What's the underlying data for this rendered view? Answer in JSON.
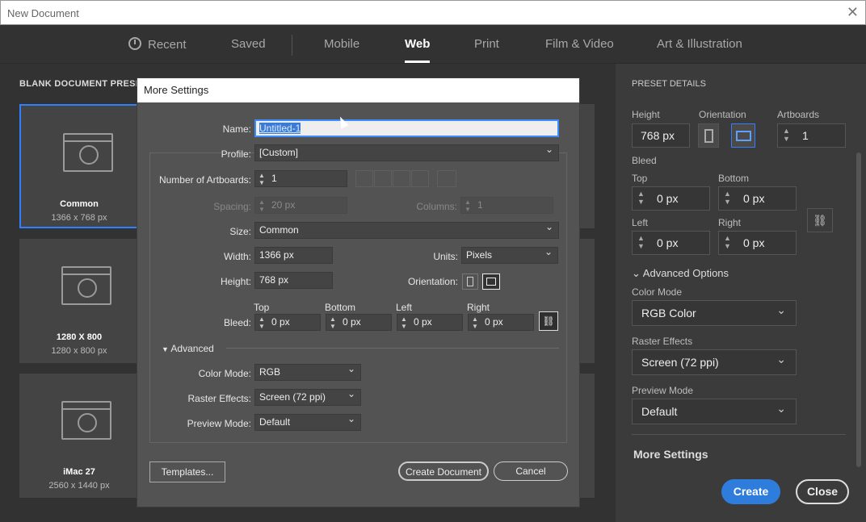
{
  "window": {
    "title": "New Document",
    "close": "✕"
  },
  "tabs": [
    {
      "label": "Recent"
    },
    {
      "label": "Saved"
    },
    {
      "label": "Mobile"
    },
    {
      "label": "Web"
    },
    {
      "label": "Print"
    },
    {
      "label": "Film & Video"
    },
    {
      "label": "Art & Illustration"
    }
  ],
  "presets": {
    "header": "BLANK DOCUMENT PRESETS",
    "items": [
      {
        "name": "Common",
        "size": "1366 x 768 px"
      },
      {
        "name": "1280 X 800",
        "size": "1280 x 800 px"
      },
      {
        "name": "iMac 27",
        "size": "2560 x 1440 px"
      }
    ]
  },
  "details": {
    "header": "PRESET DETAILS",
    "height_label": "Height",
    "height": "768 px",
    "orientation_label": "Orientation",
    "artboards_label": "Artboards",
    "artboards": "1",
    "bleed_label": "Bleed",
    "top_label": "Top",
    "top": "0 px",
    "bottom_label": "Bottom",
    "bottom": "0 px",
    "left_label": "Left",
    "left": "0 px",
    "right_label": "Right",
    "right": "0 px",
    "advanced": "Advanced Options",
    "color_mode_label": "Color Mode",
    "color_mode": "RGB Color",
    "raster_label": "Raster Effects",
    "raster": "Screen (72 ppi)",
    "preview_label": "Preview Mode",
    "preview": "Default",
    "more_settings": "More Settings",
    "create": "Create",
    "close": "Close"
  },
  "dialog": {
    "title": "More Settings",
    "name_label": "Name:",
    "name": "Untitled-1",
    "profile_label": "Profile:",
    "profile": "[Custom]",
    "artboards_label": "Number of Artboards:",
    "artboards": "1",
    "spacing_label": "Spacing:",
    "spacing": "20 px",
    "columns_label": "Columns:",
    "columns": "1",
    "size_label": "Size:",
    "size": "Common",
    "width_label": "Width:",
    "width": "1366 px",
    "units_label": "Units:",
    "units": "Pixels",
    "height_label": "Height:",
    "height": "768 px",
    "orientation_label": "Orientation:",
    "bleed_label": "Bleed:",
    "top_label": "Top",
    "top": "0 px",
    "bottom_label": "Bottom",
    "bottom": "0 px",
    "left_label": "Left",
    "left": "0 px",
    "right_label": "Right",
    "right": "0 px",
    "advanced_label": "Advanced",
    "color_mode_label": "Color Mode:",
    "color_mode": "RGB",
    "raster_label": "Raster Effects:",
    "raster": "Screen (72 ppi)",
    "preview_label": "Preview Mode:",
    "preview": "Default",
    "templates": "Templates...",
    "create": "Create Document",
    "cancel": "Cancel"
  }
}
